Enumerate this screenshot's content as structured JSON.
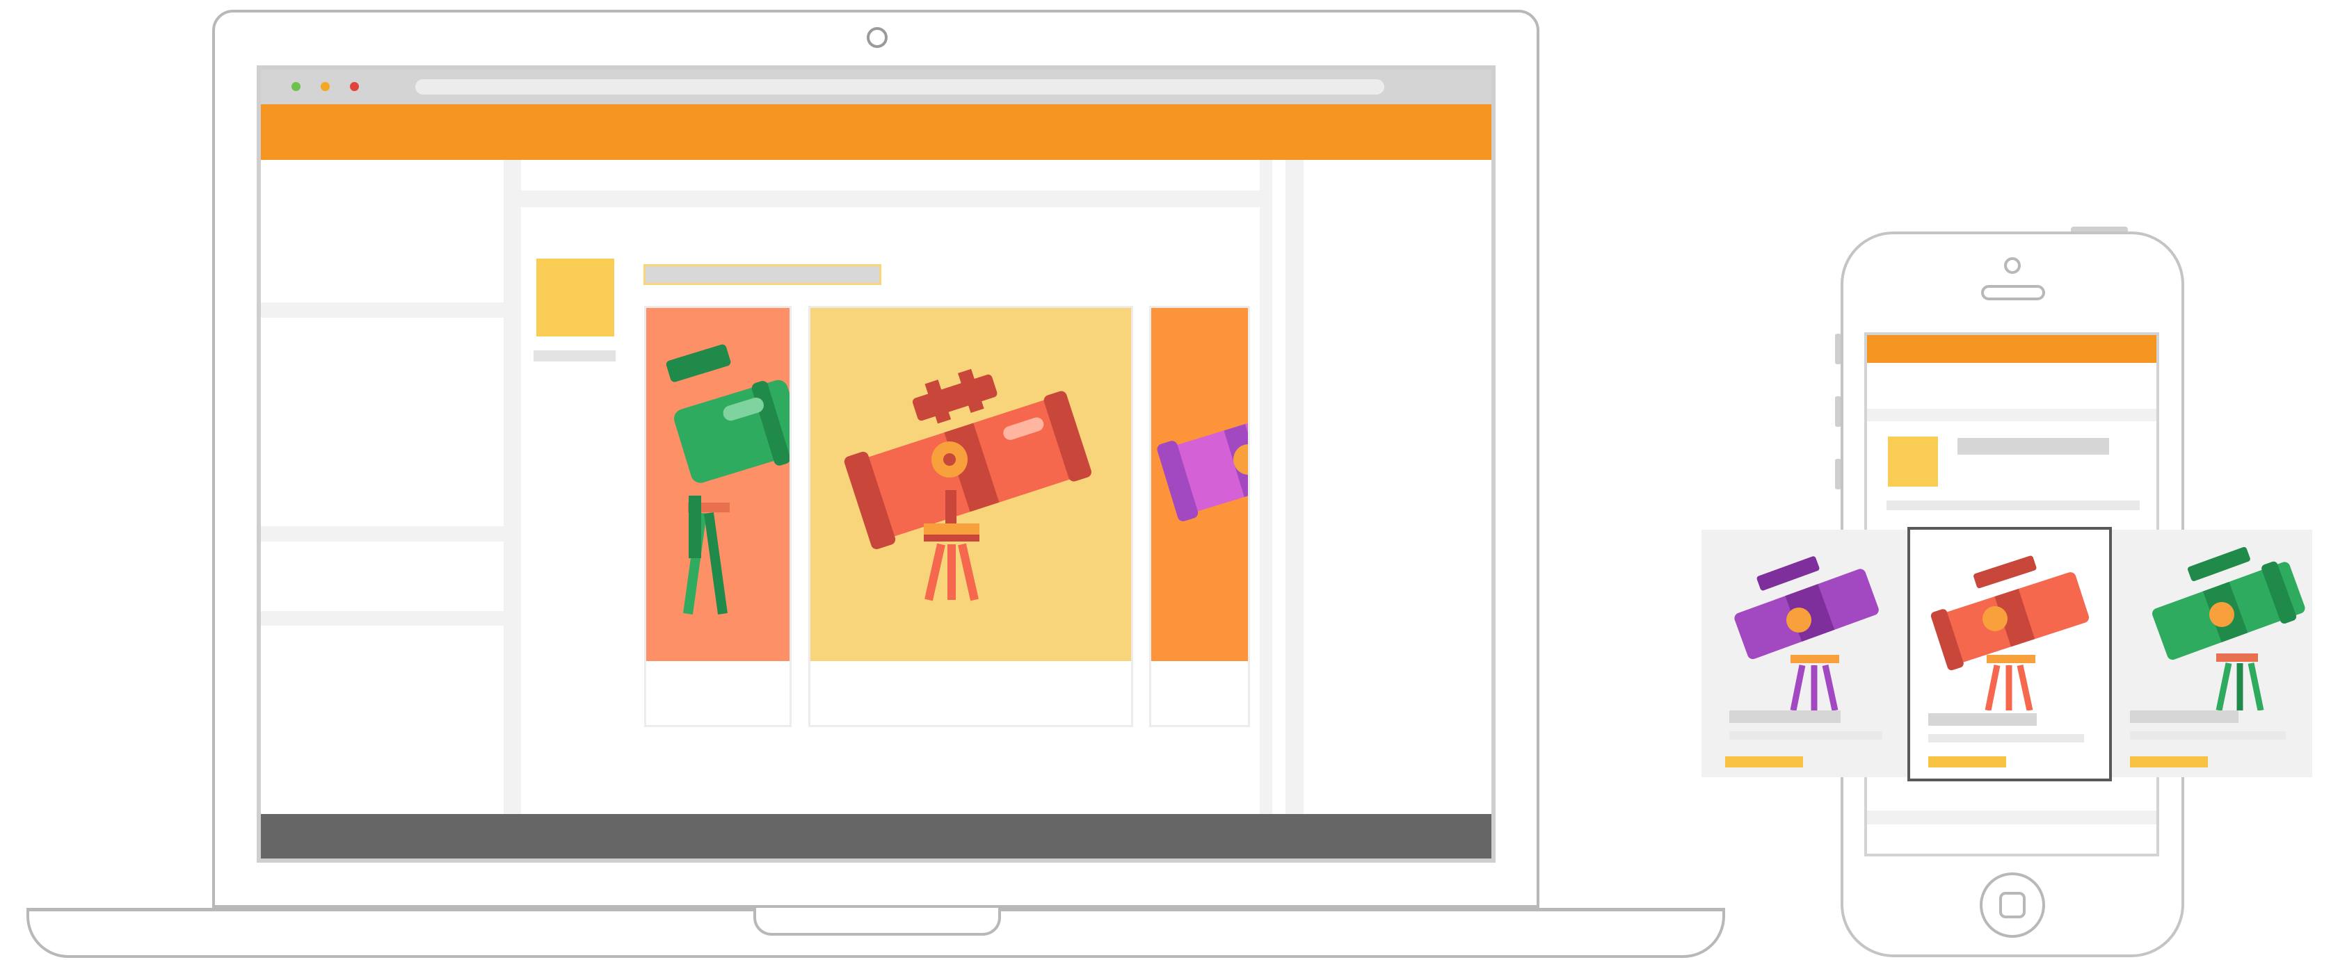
{
  "scene": "laptop-and-phone-website-mockup",
  "colors": {
    "header_orange": "#f59622",
    "footer_gray": "#666666",
    "accent_yellow": "#f8c242",
    "card_salmon": "#fd9066",
    "card_yellow": "#f8d57a",
    "card_orange": "#fd9439",
    "telescope_green": "#2fab5f",
    "telescope_red": "#f5684e",
    "telescope_purple": "#a249c1"
  },
  "laptop": {
    "browser_dots": [
      "#6cc24a",
      "#f5a623",
      "#e0433b"
    ],
    "carousel": [
      {
        "telescope": "green-telescope-icon",
        "background": "#fd9066"
      },
      {
        "telescope": "red-telescope-icon",
        "background": "#f8d57a"
      },
      {
        "telescope": "purple-telescope-icon",
        "background": "#fd9439"
      }
    ]
  },
  "phone": {
    "carousel": [
      {
        "telescope": "purple-telescope-icon"
      },
      {
        "telescope": "red-telescope-icon",
        "selected": true
      },
      {
        "telescope": "green-telescope-icon"
      }
    ]
  }
}
